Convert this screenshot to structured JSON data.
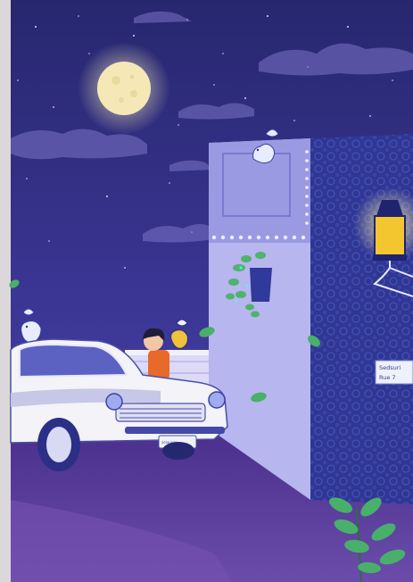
{
  "wall_sign": {
    "line1": "Sedsuri",
    "line2": "Rue 7"
  },
  "license_plate": {
    "text": "2050 RUE"
  },
  "colors": {
    "sky_top": "#2b2a78",
    "sky_bottom": "#4f45a8",
    "moon": "#f3e7b2",
    "building_face": "#b9b8ee",
    "building_side": "#2d3492",
    "lamp_glow": "#f6c530",
    "car_body": "#f4f4f8",
    "ground": "#5a3f9c",
    "leaf_green": "#41b56b"
  }
}
